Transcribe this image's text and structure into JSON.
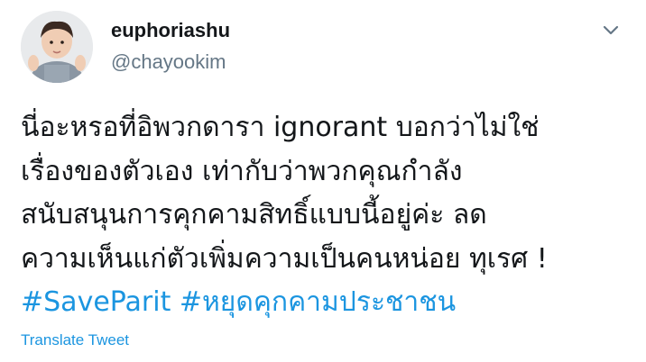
{
  "author": {
    "display_name": "euphoriashu",
    "username": "@chayookim"
  },
  "tweet": {
    "lines": [
      "นี่อะหรอที่อิพวกดารา ignorant บอกว่าไม่ใช่",
      "เรื่องของตัวเอง เท่ากับว่าพวกคุณกำลัง",
      "สนับสนุนการคุกคามสิทธิ์แบบนี้อยู่ค่ะ ลด",
      "ความเห็นแก่ตัวเพิ่มความเป็นคนหน่อย ทุเรศ !"
    ],
    "hashtags": [
      "#SaveParit",
      "#หยุดคุกคามประชาชน"
    ]
  },
  "actions": {
    "translate_label": "Translate Tweet"
  },
  "icons": {
    "menu": "chevron-down-icon",
    "avatar": "avatar"
  },
  "colors": {
    "link": "#1b95e0",
    "secondary_text": "#657786",
    "primary_text": "#14171a"
  }
}
